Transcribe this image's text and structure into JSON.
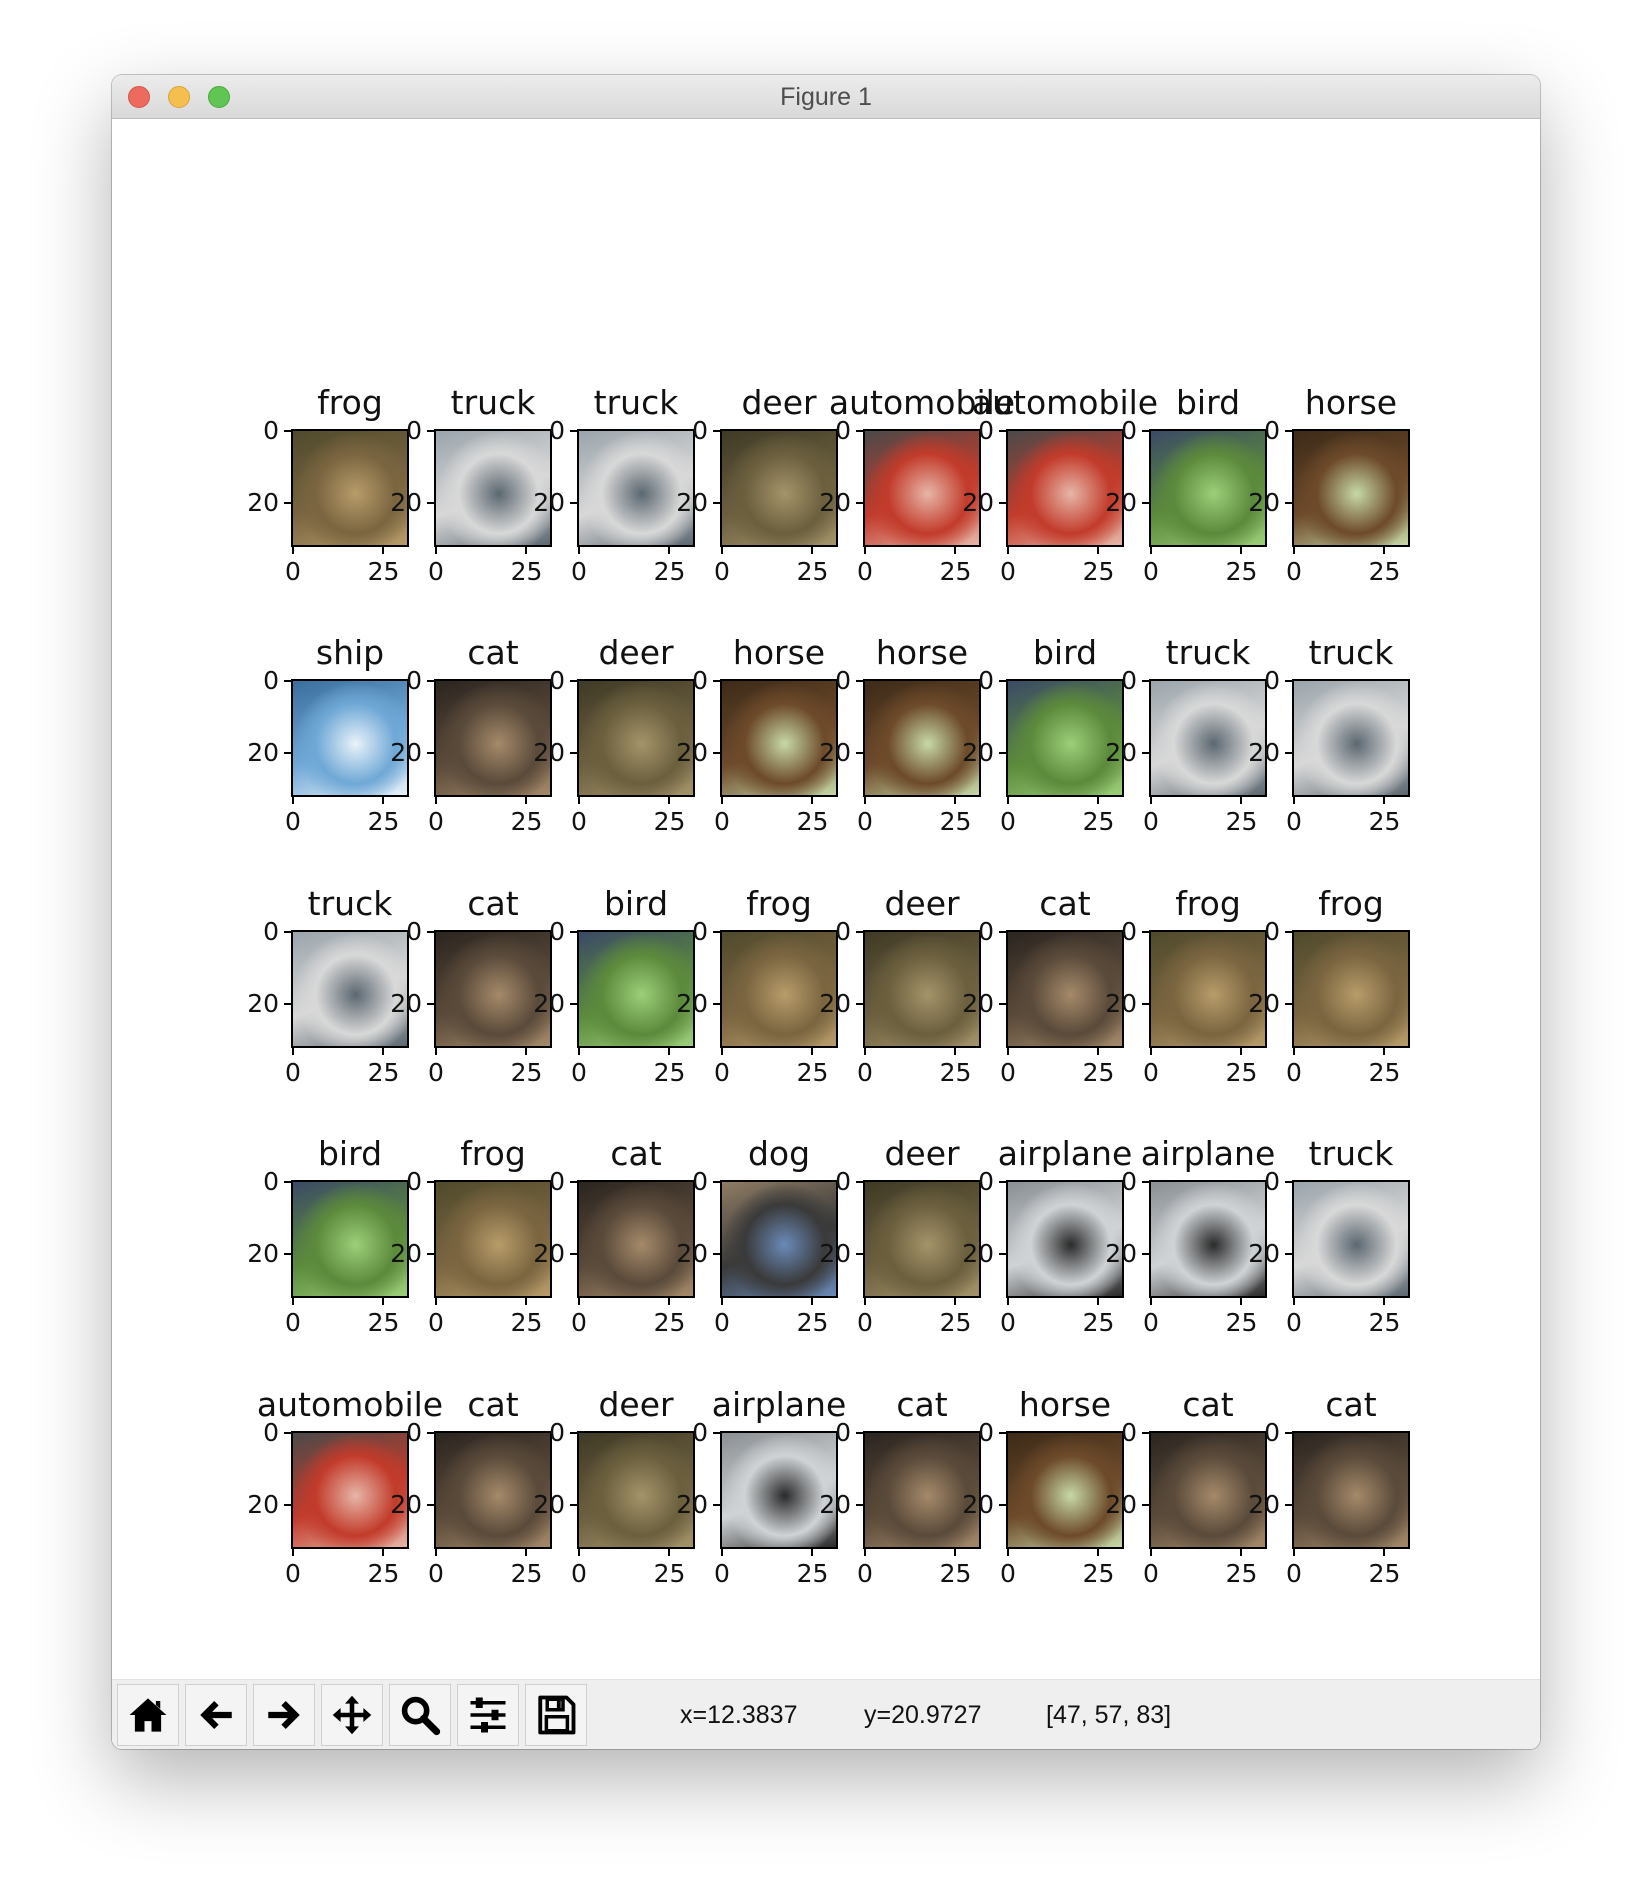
{
  "window": {
    "title": "Figure 1"
  },
  "figure": {
    "ytick_labels": [
      "0",
      "20"
    ],
    "xtick_labels": [
      "0",
      "25"
    ],
    "rows": [
      [
        "frog",
        "truck",
        "truck",
        "deer",
        "automobile",
        "automobile",
        "bird",
        "horse"
      ],
      [
        "ship",
        "cat",
        "deer",
        "horse",
        "horse",
        "bird",
        "truck",
        "truck"
      ],
      [
        "truck",
        "cat",
        "bird",
        "frog",
        "deer",
        "cat",
        "frog",
        "frog"
      ],
      [
        "bird",
        "frog",
        "cat",
        "dog",
        "deer",
        "airplane",
        "airplane",
        "truck"
      ],
      [
        "automobile",
        "cat",
        "deer",
        "airplane",
        "cat",
        "horse",
        "cat",
        "cat"
      ]
    ]
  },
  "toolbar": {
    "buttons": [
      {
        "name": "home-icon",
        "label": "Home"
      },
      {
        "name": "back-arrow-icon",
        "label": "Back"
      },
      {
        "name": "forward-arrow-icon",
        "label": "Forward"
      },
      {
        "name": "pan-move-icon",
        "label": "Pan"
      },
      {
        "name": "zoom-magnifier-icon",
        "label": "Zoom"
      },
      {
        "name": "subplots-sliders-icon",
        "label": "Configure subplots"
      },
      {
        "name": "save-floppy-icon",
        "label": "Save"
      }
    ],
    "x_readout": "x=12.3837",
    "y_readout": "y=20.9727",
    "pixel_readout": "[47, 57, 83]"
  }
}
